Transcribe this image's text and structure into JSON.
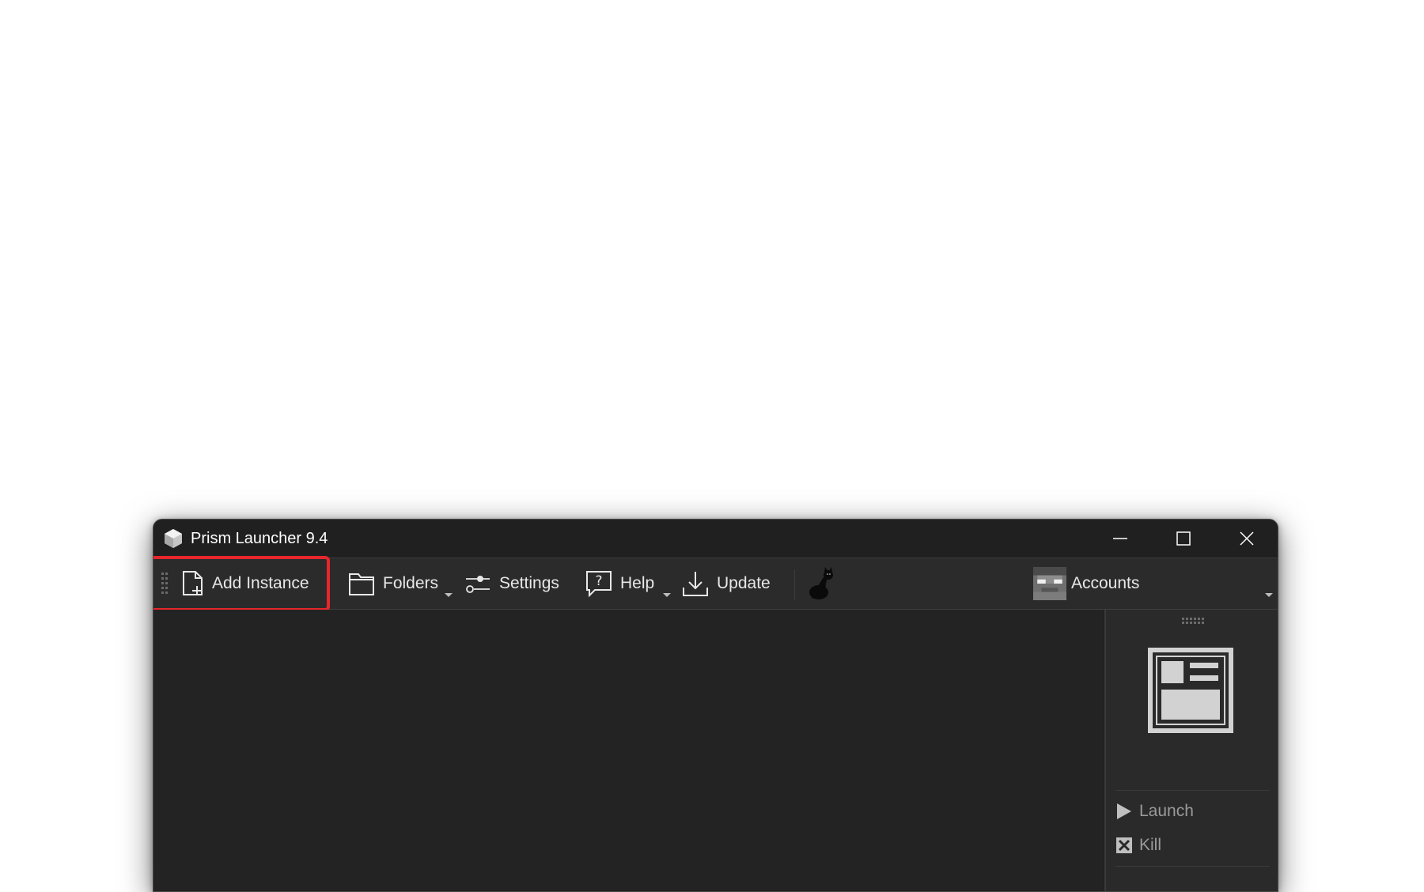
{
  "window": {
    "title": "Prism Launcher 9.4",
    "controls": [
      "minimize",
      "maximize",
      "close"
    ]
  },
  "toolbar": {
    "add_instance_label": "Add Instance",
    "folders_label": "Folders",
    "settings_label": "Settings",
    "help_label": "Help",
    "update_label": "Update",
    "cat_icon": "black-cat-icon",
    "accounts_label": "Accounts"
  },
  "sidepanel": {
    "actions": [
      {
        "label": "Launch",
        "icon": "play-icon"
      },
      {
        "label": "Kill",
        "icon": "kill-icon"
      }
    ]
  },
  "colors": {
    "window_bg": "#1f1f1f",
    "toolbar_bg": "#2b2b2b",
    "highlight": "#e8262b",
    "text": "#e8e8e8",
    "disabled_text": "#9a9a9a"
  }
}
